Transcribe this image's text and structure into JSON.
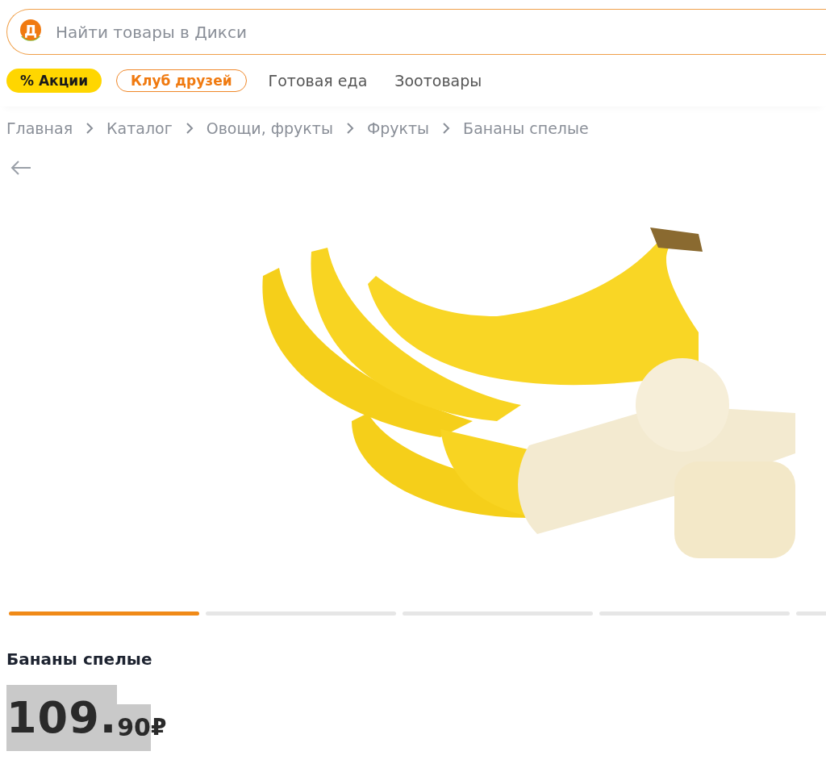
{
  "search": {
    "placeholder": "Найти товары в Дикси",
    "logo_letter": "Д"
  },
  "nav": [
    {
      "label": "% Акции",
      "kind": "promo"
    },
    {
      "label": "Клуб друзей",
      "kind": "club"
    },
    {
      "label": "Готовая еда",
      "kind": "plain"
    },
    {
      "label": "Зоотовары",
      "kind": "plain"
    }
  ],
  "breadcrumbs": [
    "Главная",
    "Каталог",
    "Овощи, фрукты",
    "Фрукты",
    "Бананы спелые"
  ],
  "gallery": {
    "slides": [
      {
        "selected": true
      },
      {
        "selected": false
      },
      {
        "selected": false
      },
      {
        "selected": false
      },
      {
        "selected": false
      }
    ]
  },
  "product": {
    "title": "Бананы спелые",
    "price_rubles": "109.",
    "price_kopecks": "90",
    "currency": "₽"
  }
}
